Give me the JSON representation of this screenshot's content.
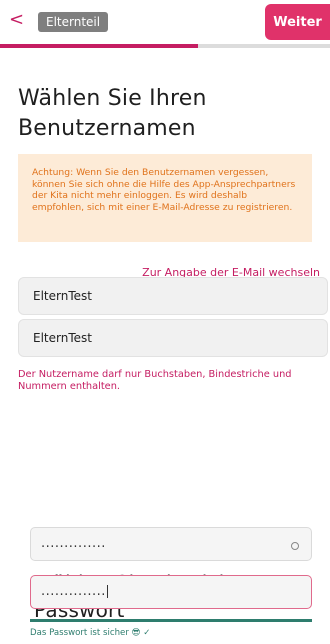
{
  "header": {
    "back_symbol": "<",
    "role_chip": "Elternteil",
    "next_label": "Weiter",
    "progress": 0.6
  },
  "username_section": {
    "title": "Wählen Sie Ihren Benutzernamen",
    "warning": "Achtung: Wenn Sie den Benutzernamen vergessen, können Sie sich ohne die Hilfe des App-Ansprechpartners der Kita nicht mehr einloggen. Es wird deshalb empfohlen, sich mit einer E-Mail-Adresse zu registrieren.",
    "switch_link": "Zur Angabe der E-Mail wechseln",
    "username_value": "ElternTest",
    "username_confirm_value": "ElternTest",
    "hint": "Der Nutzername darf nur Buchstaben, Bindestriche und Nummern enthalten."
  },
  "password_section": {
    "title": "Wählen Sie ein sicheres Passwort",
    "password_masked": "..............",
    "password_confirm_masked": "..............",
    "strength_text": "Das Passwort ist sicher",
    "strength_emoji": "😎",
    "strength_check": "✓"
  },
  "colors": {
    "accent": "#c51d62",
    "button": "#e0326a",
    "warning_bg": "#fdebd7",
    "warning_text": "#e0731c",
    "success": "#2e7d6e"
  }
}
